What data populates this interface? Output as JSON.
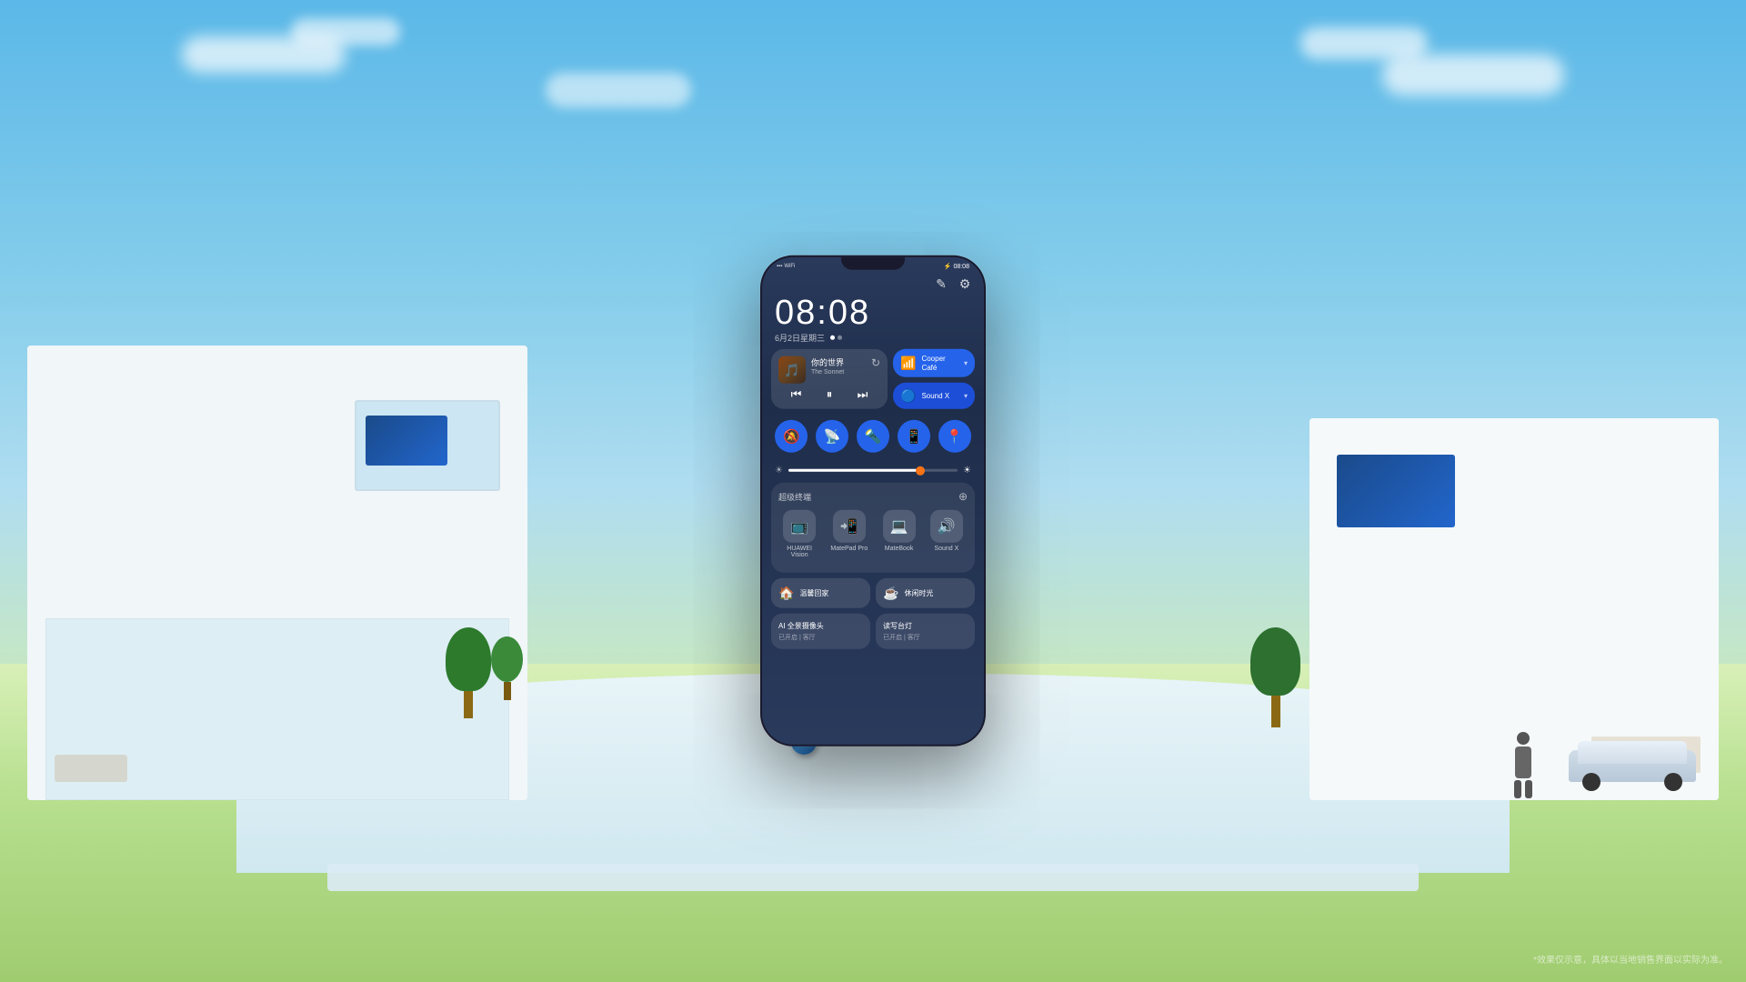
{
  "background": {
    "sky_color_top": "#5bb8e8",
    "sky_color_bottom": "#87ceeb",
    "grass_color": "#90c870"
  },
  "phone": {
    "status_bar": {
      "time": "08:08",
      "signal": "▪▪▪",
      "wifi": "wifi",
      "battery": "08:08"
    },
    "header_icons": {
      "edit_icon": "✎",
      "settings_icon": "⚙"
    },
    "time": {
      "big": "08:08",
      "date": "6月2日星期三"
    },
    "dot_indicators": [
      "active",
      "inactive"
    ],
    "music": {
      "song_title": "你的世界",
      "song_artist": "The Sonnet",
      "album_emoji": "🎵",
      "prev": "⏮",
      "play_pause": "⏸",
      "next": "⏭",
      "rotate": "↻"
    },
    "wifi_card": {
      "icon": "📶",
      "name": "Cooper",
      "sub": "Café",
      "arrow": "▾"
    },
    "bluetooth_card": {
      "icon": "🔵",
      "name": "Sound X",
      "sub": "",
      "arrow": "▾"
    },
    "toggles": [
      {
        "icon": "🔕",
        "label": "silent"
      },
      {
        "icon": "📡",
        "label": "vibrate"
      },
      {
        "icon": "🔦",
        "label": "torch"
      },
      {
        "icon": "📱",
        "label": "mirror"
      },
      {
        "icon": "📍",
        "label": "location"
      }
    ],
    "brightness": {
      "low_icon": "☀",
      "high_icon": "☀",
      "fill_percent": 78
    },
    "devices_section": {
      "title": "超级终端",
      "settings_icon": "⚙",
      "devices": [
        {
          "icon": "📺",
          "label": "HUAWEI\nVision"
        },
        {
          "icon": "💻",
          "label": "MatePad Pro"
        },
        {
          "icon": "💻",
          "label": "MateBook"
        },
        {
          "icon": "🔊",
          "label": "Sound X"
        }
      ]
    },
    "scenes": [
      {
        "icon": "🏠",
        "label": "温馨回家"
      },
      {
        "icon": "☕",
        "label": "休闲时光"
      }
    ],
    "iot_cards": [
      {
        "title": "AI 全景摄像头",
        "sub": "已开启 | 客厅"
      },
      {
        "title": "读写台灯",
        "sub": "已开启 | 客厅"
      }
    ]
  },
  "disclaimer": "*效果仅示意，具体以当地销售界面以实际为准。"
}
